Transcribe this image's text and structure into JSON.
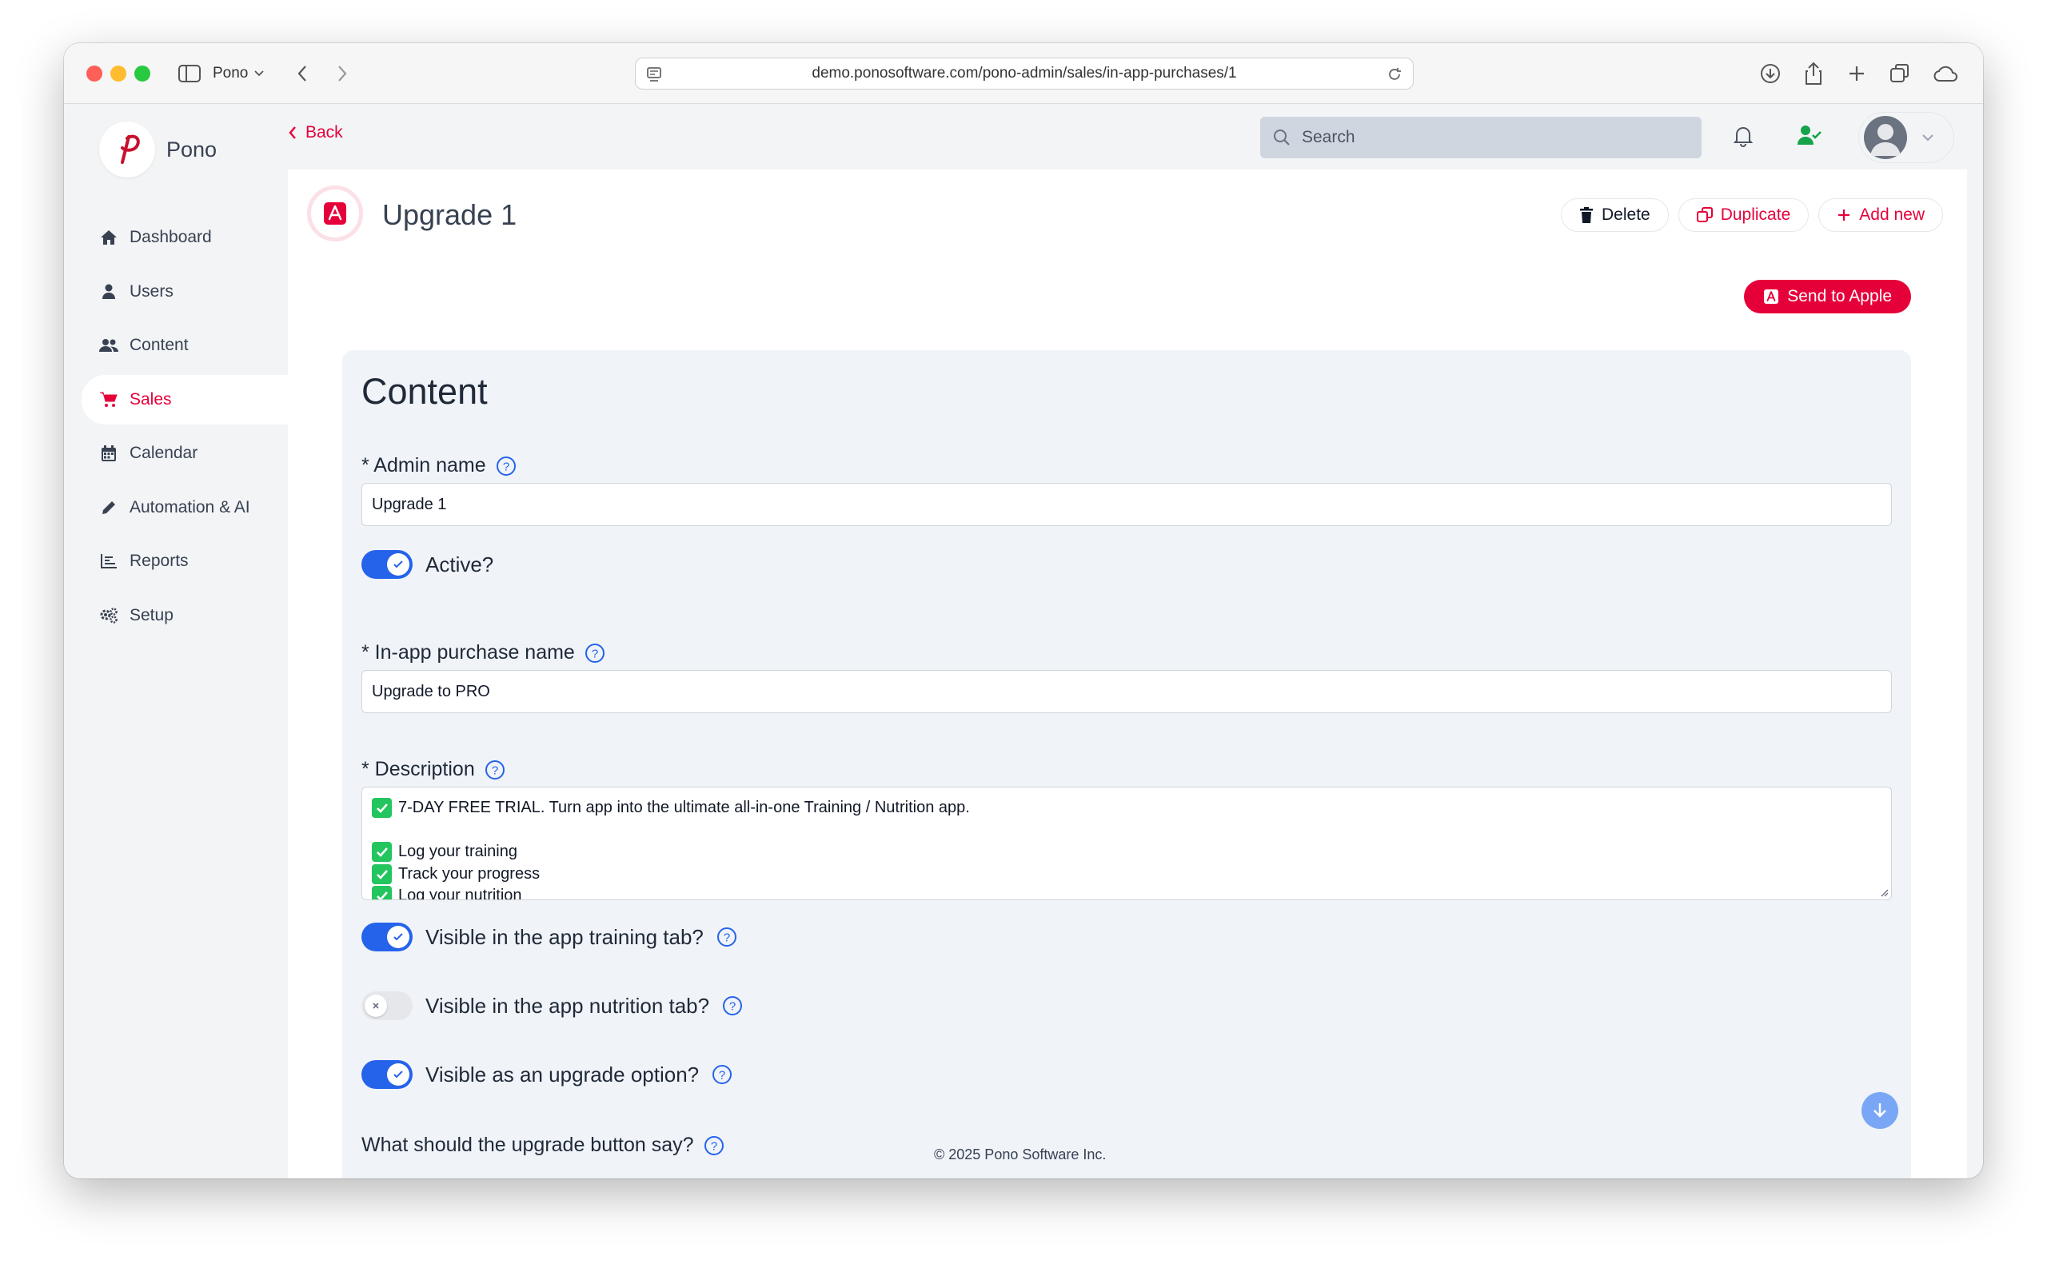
{
  "browser": {
    "profile": "Pono",
    "url": "demo.ponosoftware.com/pono-admin/sales/in-app-purchases/1"
  },
  "sidebar": {
    "logo_text": "Pono",
    "items": [
      {
        "label": "Dashboard",
        "icon": "home-icon"
      },
      {
        "label": "Users",
        "icon": "user-icon"
      },
      {
        "label": "Content",
        "icon": "users-icon"
      },
      {
        "label": "Sales",
        "icon": "cart-icon",
        "active": true
      },
      {
        "label": "Calendar",
        "icon": "calendar-icon"
      },
      {
        "label": "Automation & AI",
        "icon": "pencil-icon"
      },
      {
        "label": "Reports",
        "icon": "chart-icon"
      },
      {
        "label": "Setup",
        "icon": "gears-icon"
      }
    ]
  },
  "topbar": {
    "back_label": "Back",
    "search_placeholder": "Search"
  },
  "page": {
    "title": "Upgrade 1",
    "actions": {
      "delete": "Delete",
      "duplicate": "Duplicate",
      "add_new": "Add new"
    },
    "send_to_apple": "Send to Apple"
  },
  "form": {
    "section_title": "Content",
    "admin_name": {
      "label": "* Admin name",
      "value": "Upgrade 1"
    },
    "active": {
      "label": "Active?",
      "on": true
    },
    "iap_name": {
      "label": "* In-app purchase name",
      "value": "Upgrade to PRO"
    },
    "description": {
      "label": "* Description",
      "lines": [
        "7-DAY FREE TRIAL. Turn app into the ultimate all-in-one Training / Nutrition app.",
        "",
        "Log your training",
        "Track your progress",
        "Log your nutrition"
      ]
    },
    "visible_training": {
      "label": "Visible in the app training tab?",
      "on": true
    },
    "visible_nutrition": {
      "label": "Visible in the app nutrition tab?",
      "on": false
    },
    "visible_upgrade": {
      "label": "Visible as an upgrade option?",
      "on": true
    },
    "upgrade_button_text": {
      "label": "What should the upgrade button say?"
    }
  },
  "footer": "© 2025 Pono Software Inc.",
  "colors": {
    "brand": "#e6003a",
    "toggle_on": "#2563eb",
    "check": "#22c55e"
  }
}
